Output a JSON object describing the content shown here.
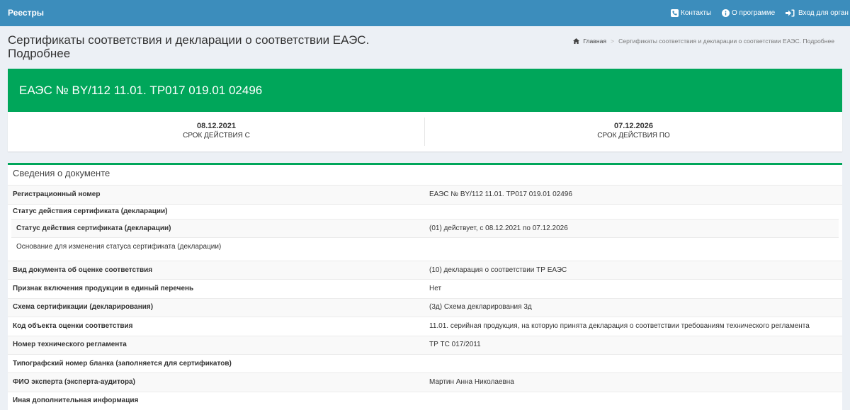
{
  "colors": {
    "navbar": "#3c8dbc",
    "background": "#ecf0f5",
    "accent_green": "#00a65a",
    "text": "#333333"
  },
  "navbar": {
    "brand": "Реестры",
    "contacts": {
      "icon": "phone-square-icon",
      "label": "Контакты"
    },
    "about": {
      "icon": "info-circle-icon",
      "label": "О программе"
    },
    "login": {
      "icon": "sign-in-icon",
      "label": "Вход для орган"
    }
  },
  "page_header": {
    "title": "Сертификаты соответствия и декларации о соответствии ЕАЭС. Подробнее",
    "breadcrumb": {
      "home_icon": "home-icon",
      "home": "Главная",
      "separator": ">",
      "current": "Сертификаты соответствия и декларации о соответствии ЕАЭС. Подробнее"
    }
  },
  "certificate": {
    "number": "ЕАЭС № BY/112 11.01. ТР017 019.01 02496",
    "valid_from": {
      "date": "08.12.2021",
      "label": "СРОК ДЕЙСТВИЯ С"
    },
    "valid_to": {
      "date": "07.12.2026",
      "label": "СРОК ДЕЙСТВИЯ ПО"
    }
  },
  "details": {
    "title": "Сведения о документе",
    "registration_number": {
      "label": "Регистрационный номер",
      "value": "ЕАЭС № BY/112 11.01. ТР017 019.01 02496"
    },
    "status_group": {
      "label": "Статус действия сертификата (декларации)",
      "status": {
        "label": "Статус действия сертификата (декларации)",
        "value": "(01) действует, с 08.12.2021 по 07.12.2026"
      },
      "status_change_basis": {
        "label": "Основание для изменения статуса сертификата (декларации)"
      }
    },
    "rows": [
      {
        "label": "Вид документа об оценке соответствия",
        "value": "(10) декларация о соответствии ТР ЕАЭС"
      },
      {
        "label": "Признак включения продукции в единый перечень",
        "value": "Нет"
      },
      {
        "label": "Схема сертификации (декларирования)",
        "value": "(3д) Схема декларирования 3д"
      },
      {
        "label": "Код объекта оценки соответствия",
        "value": "11.01. серийная продукция, на которую принята декларация о соответствии требованиям технического регламента"
      },
      {
        "label": "Номер технического регламента",
        "value": "ТР ТС 017/2011"
      },
      {
        "label": "Типографский номер бланка (заполняется для сертификатов)"
      },
      {
        "label": "ФИО эксперта (эксперта-аудитора)",
        "value": "Мартин Анна Николаевна"
      },
      {
        "label": "Иная дополнительная информация"
      }
    ]
  }
}
